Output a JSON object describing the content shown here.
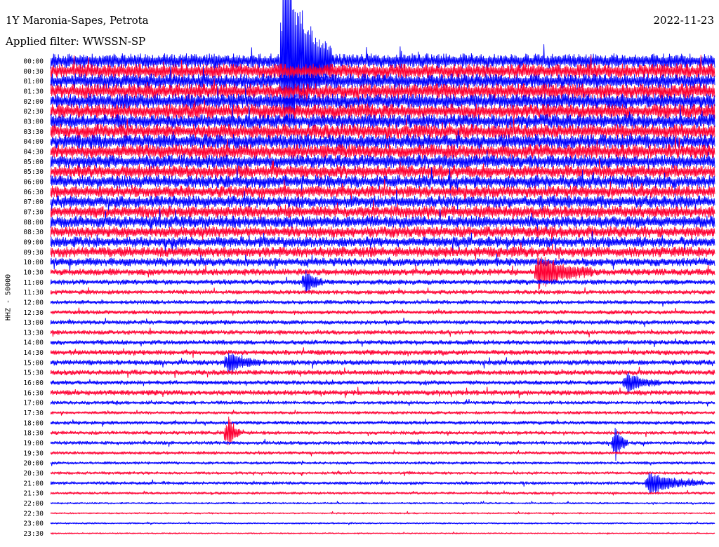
{
  "header": {
    "station": "1Y Maronia-Sapes, Petrota",
    "date": "2022-11-23",
    "filter": "Applied filter: WWSSN-SP"
  },
  "side_label": "HHZ - 50000",
  "colors": {
    "blue": "#0000ff",
    "red": "#ff0033",
    "text": "#000000",
    "background": "#ffffff"
  },
  "chart_data": {
    "type": "line",
    "title": "1Y Maronia-Sapes, Petrota",
    "ylabel": "HHZ - 50000",
    "rows": [
      "00:00",
      "00:30",
      "01:00",
      "01:30",
      "02:00",
      "02:30",
      "03:00",
      "03:30",
      "04:00",
      "04:30",
      "05:00",
      "05:30",
      "06:00",
      "06:30",
      "07:00",
      "07:30",
      "08:00",
      "08:30",
      "09:00",
      "09:30",
      "10:00",
      "10:30",
      "11:00",
      "11:30",
      "12:00",
      "12:30",
      "13:00",
      "13:30",
      "14:00",
      "14:30",
      "15:00",
      "15:30",
      "16:00",
      "16:30",
      "17:00",
      "17:30",
      "18:00",
      "18:30",
      "19:00",
      "19:30",
      "20:00",
      "20:30",
      "21:00",
      "21:30",
      "22:00",
      "22:30",
      "23:00",
      "23:30"
    ],
    "series_colors": [
      "#0000ff",
      "#ff0033"
    ],
    "row_interval_minutes": 30,
    "relative_noise_amplitude": [
      1.0,
      1.0,
      1.0,
      1.0,
      1.0,
      1.0,
      0.95,
      0.95,
      0.95,
      0.95,
      0.9,
      0.85,
      0.85,
      0.8,
      0.8,
      0.8,
      0.8,
      0.75,
      0.7,
      0.7,
      0.55,
      0.45,
      0.35,
      0.3,
      0.28,
      0.28,
      0.3,
      0.3,
      0.32,
      0.34,
      0.36,
      0.35,
      0.3,
      0.35,
      0.25,
      0.22,
      0.25,
      0.25,
      0.25,
      0.22,
      0.2,
      0.2,
      0.22,
      0.18,
      0.14,
      0.12,
      0.12,
      0.1
    ],
    "events": [
      {
        "row": "00:00",
        "minute": 10.5,
        "duration_minutes": 2.2,
        "relative_amplitude": 14
      },
      {
        "row": "10:30",
        "minute": 22,
        "duration_minutes": 2.5,
        "relative_amplitude": 2.2
      },
      {
        "row": "11:00",
        "minute": 11.5,
        "duration_minutes": 0.8,
        "relative_amplitude": 1.6
      },
      {
        "row": "15:00",
        "minute": 8,
        "duration_minutes": 1.5,
        "relative_amplitude": 1.4
      },
      {
        "row": "16:00",
        "minute": 26,
        "duration_minutes": 1.5,
        "relative_amplitude": 1.3
      },
      {
        "row": "18:30",
        "minute": 8,
        "duration_minutes": 0.6,
        "relative_amplitude": 2.5
      },
      {
        "row": "19:00",
        "minute": 25.5,
        "duration_minutes": 0.6,
        "relative_amplitude": 2.5
      },
      {
        "row": "21:00",
        "minute": 27,
        "duration_minutes": 2.5,
        "relative_amplitude": 1.5
      }
    ]
  }
}
